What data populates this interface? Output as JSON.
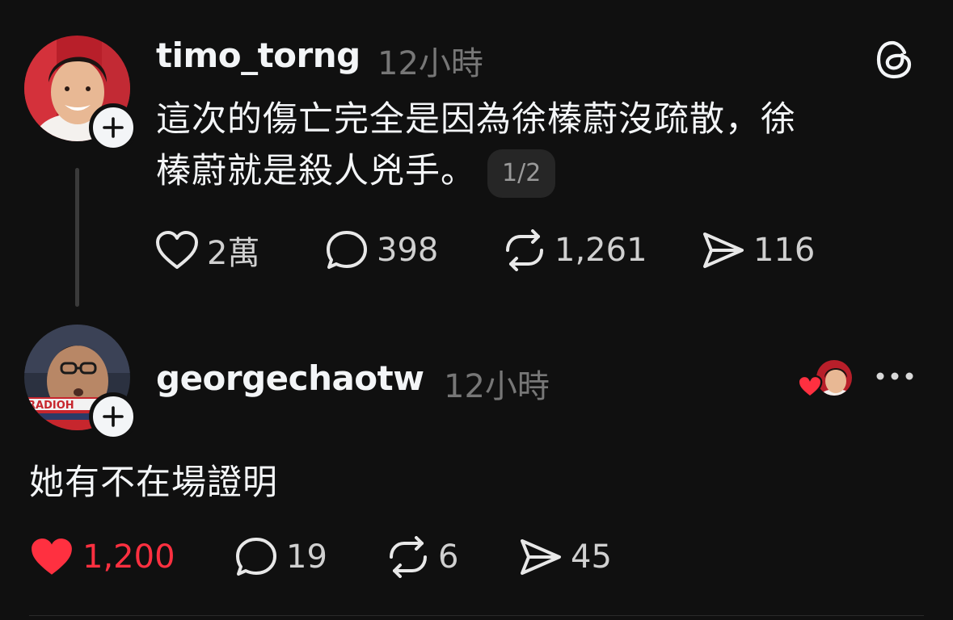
{
  "post": {
    "username": "timo_torng",
    "time": "12小時",
    "text": "這次的傷亡完全是因為徐榛蔚沒疏散，徐榛蔚就是殺人兇手。",
    "line1": "這次的傷亡完全是因為徐榛蔚沒疏散，徐",
    "line2": "榛蔚就是殺人兇手。",
    "pager": "1/2",
    "likes": "2萬",
    "replies": "398",
    "reposts": "1,261",
    "shares": "116"
  },
  "reply": {
    "username": "georgechaotw",
    "time": "12小時",
    "text": "她有不在場證明",
    "likes": "1,200",
    "replies": "19",
    "reposts": "6",
    "shares": "45",
    "avatar_banner_text": "RADIOH"
  },
  "icons": {
    "brand": "threads-logo-icon",
    "follow": "plus-icon",
    "like": "heart-icon",
    "reply": "comment-icon",
    "repost": "repost-icon",
    "share": "send-icon",
    "more": "more-icon"
  },
  "colors": {
    "background": "#101010",
    "text": "#f3f5f7",
    "muted": "#777777",
    "like_active": "#ff3040"
  }
}
